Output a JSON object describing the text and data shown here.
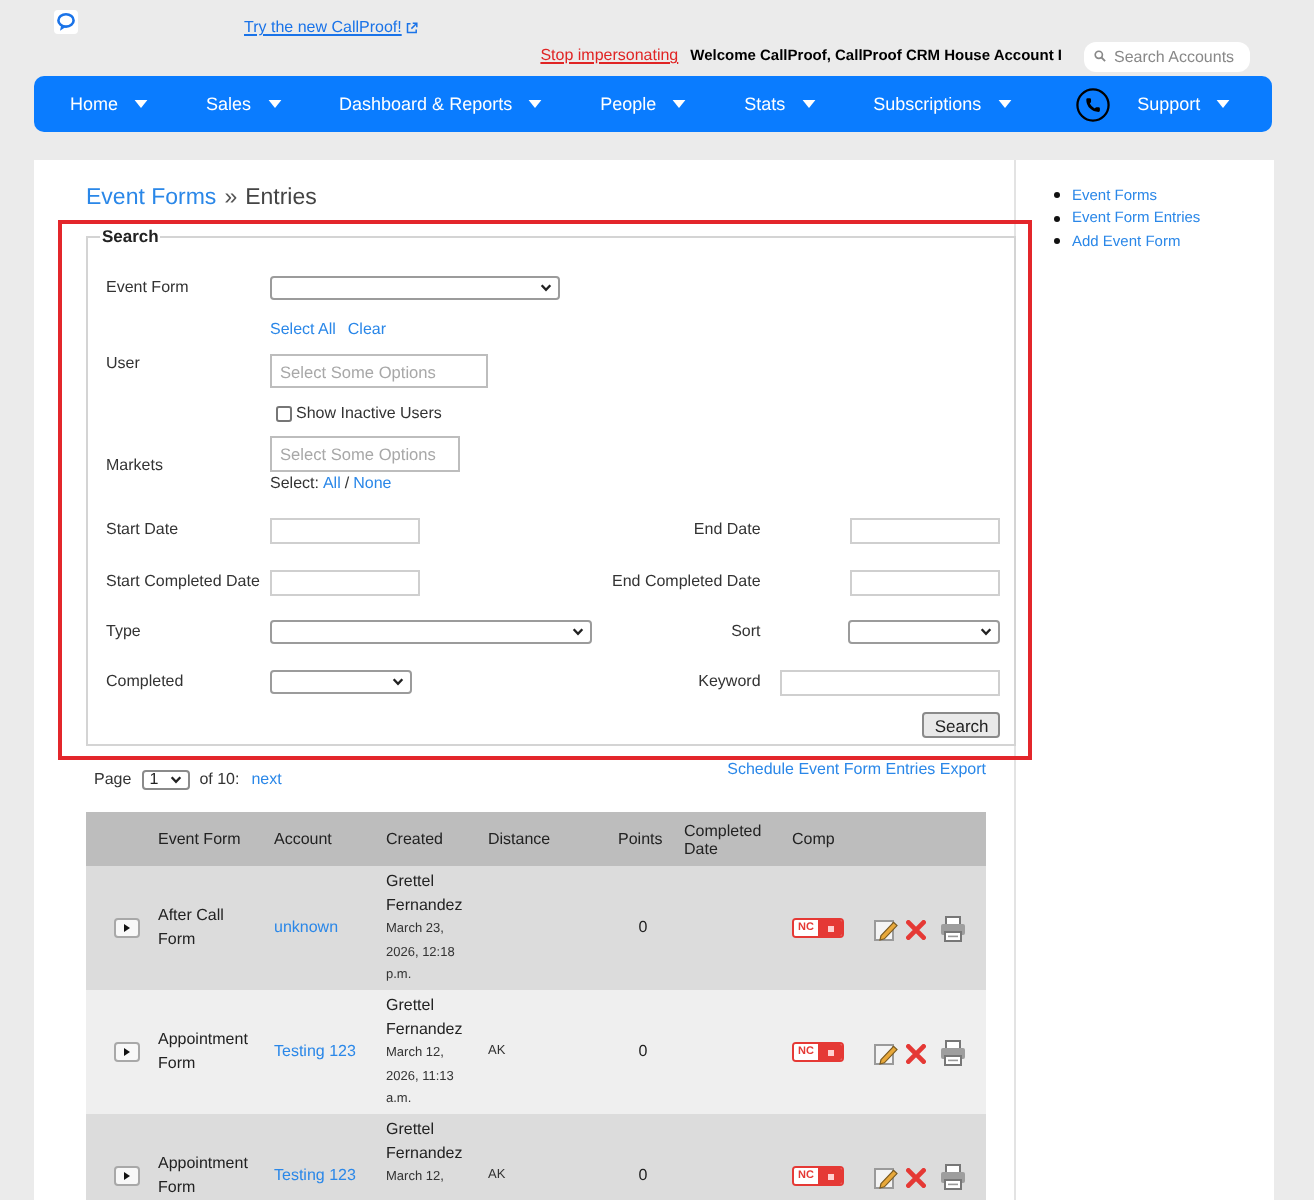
{
  "header": {
    "promo_link": "Try the new CallProof!",
    "stop_link": "Stop impersonating",
    "welcome": "Welcome CallProof, CallProof CRM House Account I",
    "search": {
      "placeholder": "Search Accounts"
    }
  },
  "nav": [
    {
      "kind": "menu",
      "label": "Home"
    },
    {
      "kind": "menu",
      "label": "Sales"
    },
    {
      "kind": "menu",
      "label": "Dashboard & Reports"
    },
    {
      "kind": "menu",
      "label": "People"
    },
    {
      "kind": "menu",
      "label": "Stats"
    },
    {
      "kind": "menu",
      "label": "Subscriptions"
    },
    {
      "kind": "phone"
    },
    {
      "kind": "menu",
      "label": "Support"
    }
  ],
  "breadcrumb": {
    "link": "Event Forms",
    "separator": "»",
    "current": "Entries"
  },
  "search_form": {
    "legend": "Search",
    "event_form": {
      "label": "Event Form"
    },
    "user": {
      "links": [
        "Select All",
        "Clear"
      ],
      "label": "User",
      "placeholder": "Select Some Options",
      "inactive": {
        "label": "Show Inactive Users",
        "checked": false
      }
    },
    "markets": {
      "label": "Markets",
      "placeholder": "Select Some Options",
      "select": {
        "prefix": "Select:",
        "all": "All",
        "separator": "/",
        "none": "None"
      }
    },
    "filters": [
      {
        "label": "Start Date",
        "kind": "date"
      },
      {
        "label": "End Date",
        "kind": "date"
      },
      {
        "label": "Start Completed Date",
        "kind": "date"
      },
      {
        "label": "End Completed Date",
        "kind": "date"
      },
      {
        "label": "Type",
        "kind": "long-select"
      },
      {
        "label": "Sort",
        "kind": "short-select"
      },
      {
        "label": "Completed",
        "kind": "short-select"
      },
      {
        "label": "Keyword",
        "kind": "text"
      }
    ],
    "button": "Search"
  },
  "pagination": {
    "label": "Page",
    "page": "1",
    "total": "of 10:",
    "next": "next"
  },
  "export_link": "Schedule Event Form Entries Export",
  "table": {
    "columns": [
      "Event Form",
      "Account",
      "Created",
      "Distance",
      "Points",
      "Completed Date",
      "Comp"
    ],
    "rows": [
      {
        "event_form": "After Call Form",
        "account": "unknown",
        "created_by": "Grettel Fernandez",
        "created_at": "March 23, 2026, 12:18 p.m.",
        "points": "0",
        "comp": {
          "label": "NC",
          "completed": false
        }
      },
      {
        "event_form": "Appointment Form",
        "account": "Testing 123",
        "created_by": "Grettel Fernandez",
        "created_at": "March 12, 2026, 11:13 a.m.",
        "distance": "AK",
        "points": "0",
        "comp": {
          "label": "NC",
          "completed": false
        }
      },
      {
        "event_form": "Appointment Form",
        "account": "Testing 123",
        "created_by": "Grettel Fernandez",
        "created_at": "March 12,",
        "distance": "AK",
        "points": "0",
        "comp": {
          "label": "NC",
          "completed": false
        }
      }
    ]
  },
  "sidebar": {
    "links": [
      "Event Forms",
      "Event Form Entries",
      "Add Event Form"
    ]
  }
}
